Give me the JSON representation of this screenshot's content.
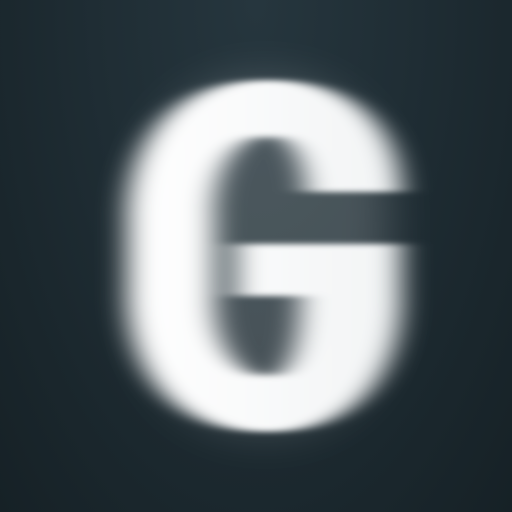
{
  "app_icon": {
    "logo": {
      "letter": "G",
      "icon": "g-letter-logo-icon",
      "foreground_color": "#ffffff",
      "background_color": "#1f2d34"
    }
  }
}
